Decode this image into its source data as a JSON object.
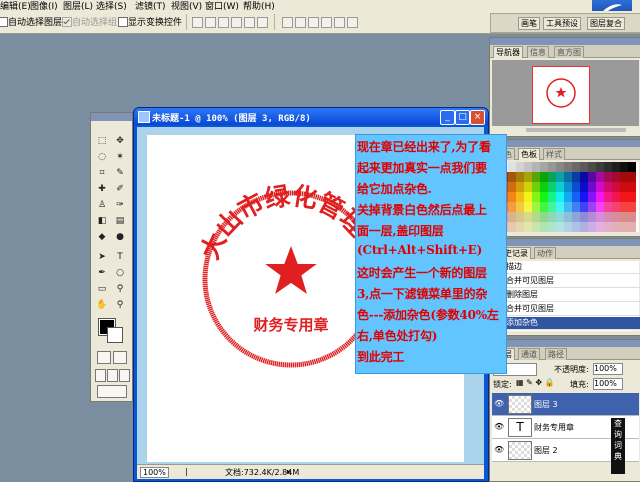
{
  "menu": [
    "编辑(E)",
    "图像(I)",
    "图层(L)",
    "选择(S)",
    "滤镜(T)",
    "视图(V)",
    "窗口(W)",
    "帮助(H)"
  ],
  "options": {
    "auto_select_layer": "自动选择图层",
    "auto_select_group": "自动选择组",
    "show_transform": "显示变换控件"
  },
  "well_tabs": [
    "画笔",
    "工具预设",
    "图层复合"
  ],
  "document": {
    "title": "未标题-1 @ 100% (图层 3, RGB/8)",
    "zoom": "100%",
    "doc_info": "文档:732.4K/2.84M"
  },
  "stamp": {
    "arc_text": "大山市绿化管理站",
    "bottom_text": "财务专用章",
    "color": "#e02020"
  },
  "note_lines": [
    "现在章已经出来了,为了看",
    "起来更加真实一点我们要",
    "给它加点杂色.",
    "关掉背景白色然后点最上",
    "面一层,盖印图层",
    "(Ctrl+Alt+Shift+E)",
    "这时会产生一个新的图层",
    "3,点一下滤镜菜单里的杂",
    "色---添加杂色(参数40%左",
    "右,单色处打勾)",
    "到此完工"
  ],
  "navigator": {
    "tabs": [
      "导航器",
      "信息",
      "直方图"
    ]
  },
  "swatches": {
    "tabs": [
      "颜色",
      "色板",
      "样式"
    ]
  },
  "history": {
    "tabs": [
      "历史记录",
      "动作"
    ],
    "items": [
      "描边",
      "合并可见图层",
      "删除图层",
      "合并可见图层",
      "添加杂色"
    ]
  },
  "layers": {
    "tabs": [
      "图层",
      "通道",
      "路径"
    ],
    "opacity_label": "不透明度:",
    "opacity": "100%",
    "lock_label": "锁定:",
    "fill_label": "填充:",
    "fill": "100%",
    "items": [
      "图层 3",
      "财务专用章",
      "图层 2"
    ]
  },
  "side_strip": "查询词典"
}
